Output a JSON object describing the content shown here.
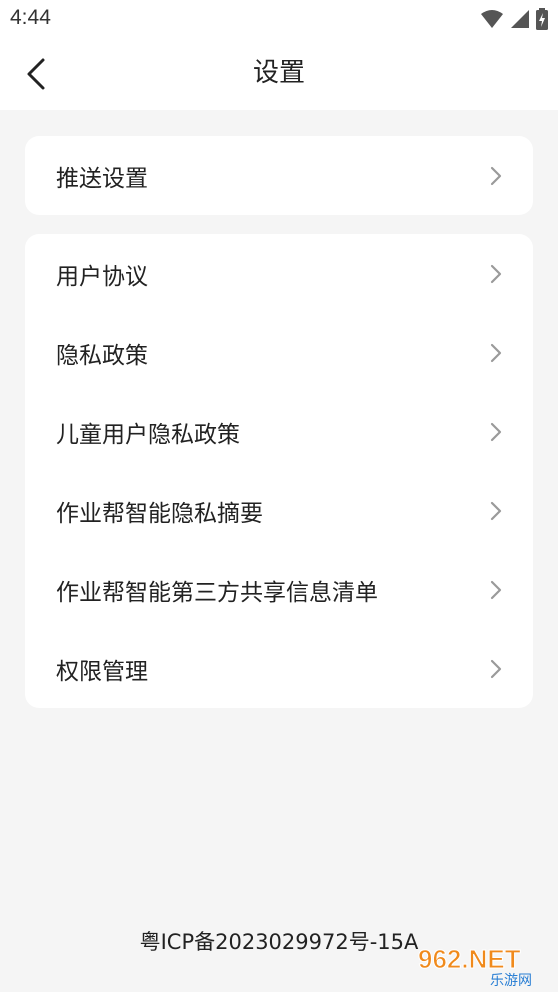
{
  "status_bar": {
    "time": "4:44",
    "icons": [
      "wifi-icon",
      "signal-icon",
      "battery-icon"
    ]
  },
  "nav": {
    "title": "设置",
    "back_icon": "chevron-left-icon"
  },
  "sections": [
    {
      "items": [
        {
          "label": "推送设置",
          "icon": "chevron-right-icon"
        }
      ]
    },
    {
      "items": [
        {
          "label": "用户协议",
          "icon": "chevron-right-icon"
        },
        {
          "label": "隐私政策",
          "icon": "chevron-right-icon"
        },
        {
          "label": "儿童用户隐私政策",
          "icon": "chevron-right-icon"
        },
        {
          "label": "作业帮智能隐私摘要",
          "icon": "chevron-right-icon"
        },
        {
          "label": "作业帮智能第三方共享信息清单",
          "icon": "chevron-right-icon"
        },
        {
          "label": "权限管理",
          "icon": "chevron-right-icon"
        }
      ]
    }
  ],
  "footer": {
    "icp": "粤ICP备2023029972号-15A"
  },
  "watermark": {
    "brand": "962.NET",
    "sub": "乐游网"
  },
  "colors": {
    "background": "#f5f5f5",
    "card": "#ffffff",
    "text": "#222222",
    "chevron": "#9a9a9a",
    "watermark_orange": "#f08a1c"
  }
}
